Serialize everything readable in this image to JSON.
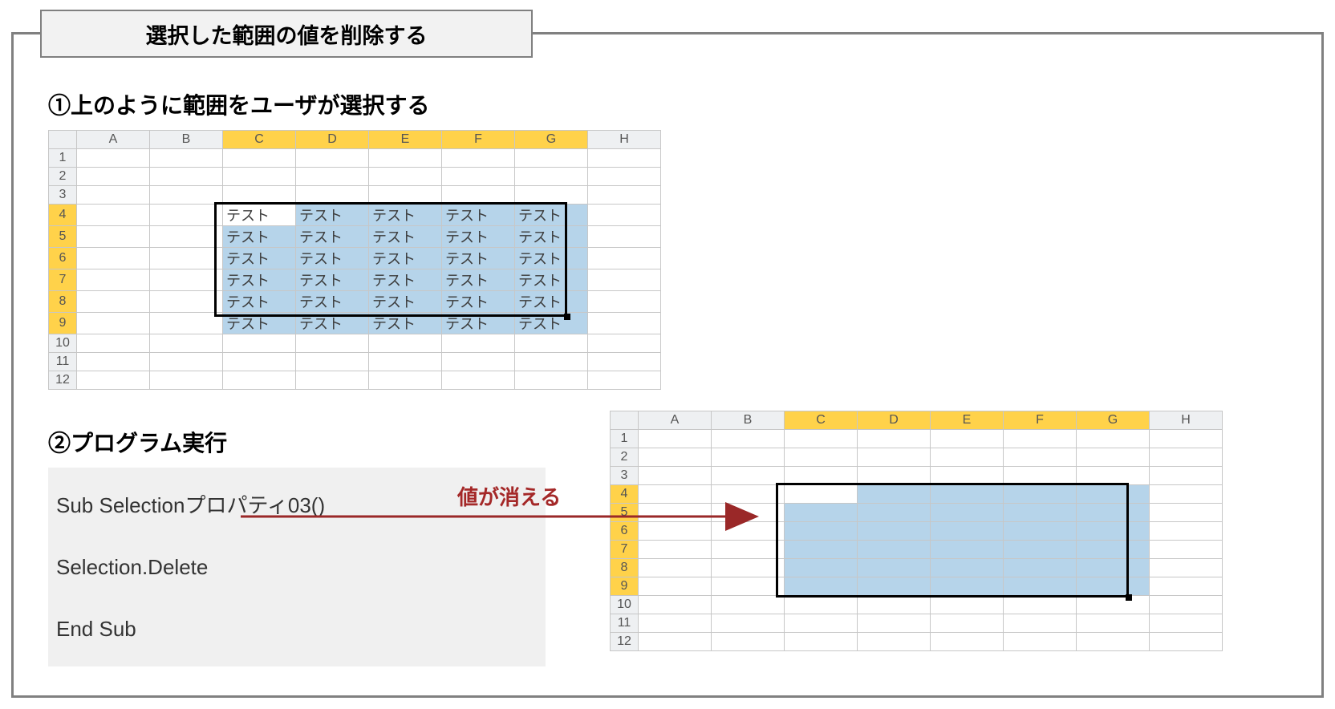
{
  "title": "選択した範囲の値を削除する",
  "step1_heading": "①上のように範囲をユーザが選択する",
  "step2_heading": "②プログラム実行",
  "code": {
    "line1": "Sub Selectionプロパティ03()",
    "line2": " Selection.Delete",
    "line3": "End Sub"
  },
  "annotation": "値が消える",
  "columns": [
    "A",
    "B",
    "C",
    "D",
    "E",
    "F",
    "G",
    "H"
  ],
  "rows": [
    "1",
    "2",
    "3",
    "4",
    "5",
    "6",
    "7",
    "8",
    "9",
    "10",
    "11",
    "12"
  ],
  "selection": {
    "cols": [
      "C",
      "D",
      "E",
      "F",
      "G"
    ],
    "rows": [
      "4",
      "5",
      "6",
      "7",
      "8",
      "9"
    ],
    "active_cell": {
      "row": "4",
      "col": "C"
    }
  },
  "cell_value": "テスト",
  "sheets": {
    "before": "populated",
    "after": "cleared"
  }
}
